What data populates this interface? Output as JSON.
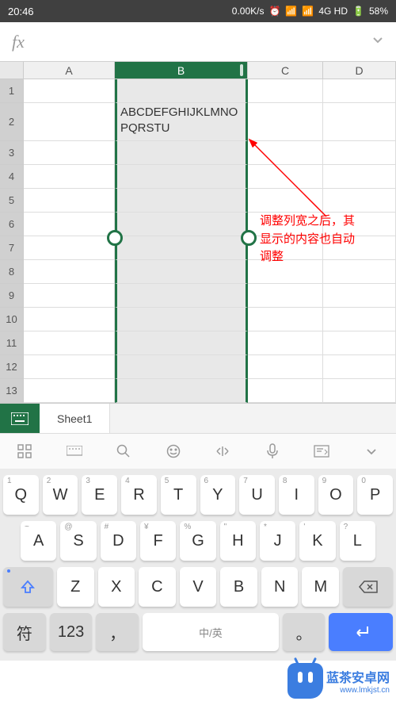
{
  "status_bar": {
    "time": "20:46",
    "speed": "0.00K/s",
    "network": "4G HD",
    "battery": "58%"
  },
  "formula_bar": {
    "fx_label": "fx"
  },
  "columns": [
    "A",
    "B",
    "C",
    "D"
  ],
  "selected_column": "B",
  "rows": [
    "1",
    "2",
    "3",
    "4",
    "5",
    "6",
    "7",
    "8",
    "9",
    "10",
    "11",
    "12",
    "13"
  ],
  "cells": {
    "B2": "ABCDEFGHIJKLMNOPQRSTU"
  },
  "annotation": {
    "text": "调整列宽之后，其显示的内容也自动调整"
  },
  "sheet_tab": "Sheet1",
  "keyboard": {
    "row1": [
      {
        "main": "Q",
        "num": "1"
      },
      {
        "main": "W",
        "num": "2"
      },
      {
        "main": "E",
        "num": "3"
      },
      {
        "main": "R",
        "num": "4"
      },
      {
        "main": "T",
        "num": "5"
      },
      {
        "main": "Y",
        "num": "6"
      },
      {
        "main": "U",
        "num": "7"
      },
      {
        "main": "I",
        "num": "8"
      },
      {
        "main": "O",
        "num": "9"
      },
      {
        "main": "P",
        "num": "0"
      }
    ],
    "row2": [
      {
        "main": "A",
        "hint": "~"
      },
      {
        "main": "S",
        "hint": "@"
      },
      {
        "main": "D",
        "hint": "#"
      },
      {
        "main": "F",
        "hint": "¥"
      },
      {
        "main": "G",
        "hint": "%"
      },
      {
        "main": "H",
        "hint": "\""
      },
      {
        "main": "J",
        "hint": "*"
      },
      {
        "main": "K",
        "hint": "'"
      },
      {
        "main": "L",
        "hint": "?"
      }
    ],
    "row3": [
      "Z",
      "X",
      "C",
      "V",
      "B",
      "N",
      "M"
    ],
    "row4": {
      "sym": "符",
      "num": "123",
      "lang": "中/英",
      "comma": "，",
      "period": "。",
      "enter": "↵"
    }
  },
  "logo": {
    "name": "蓝茶安卓网",
    "url": "www.lmkjst.cn"
  }
}
